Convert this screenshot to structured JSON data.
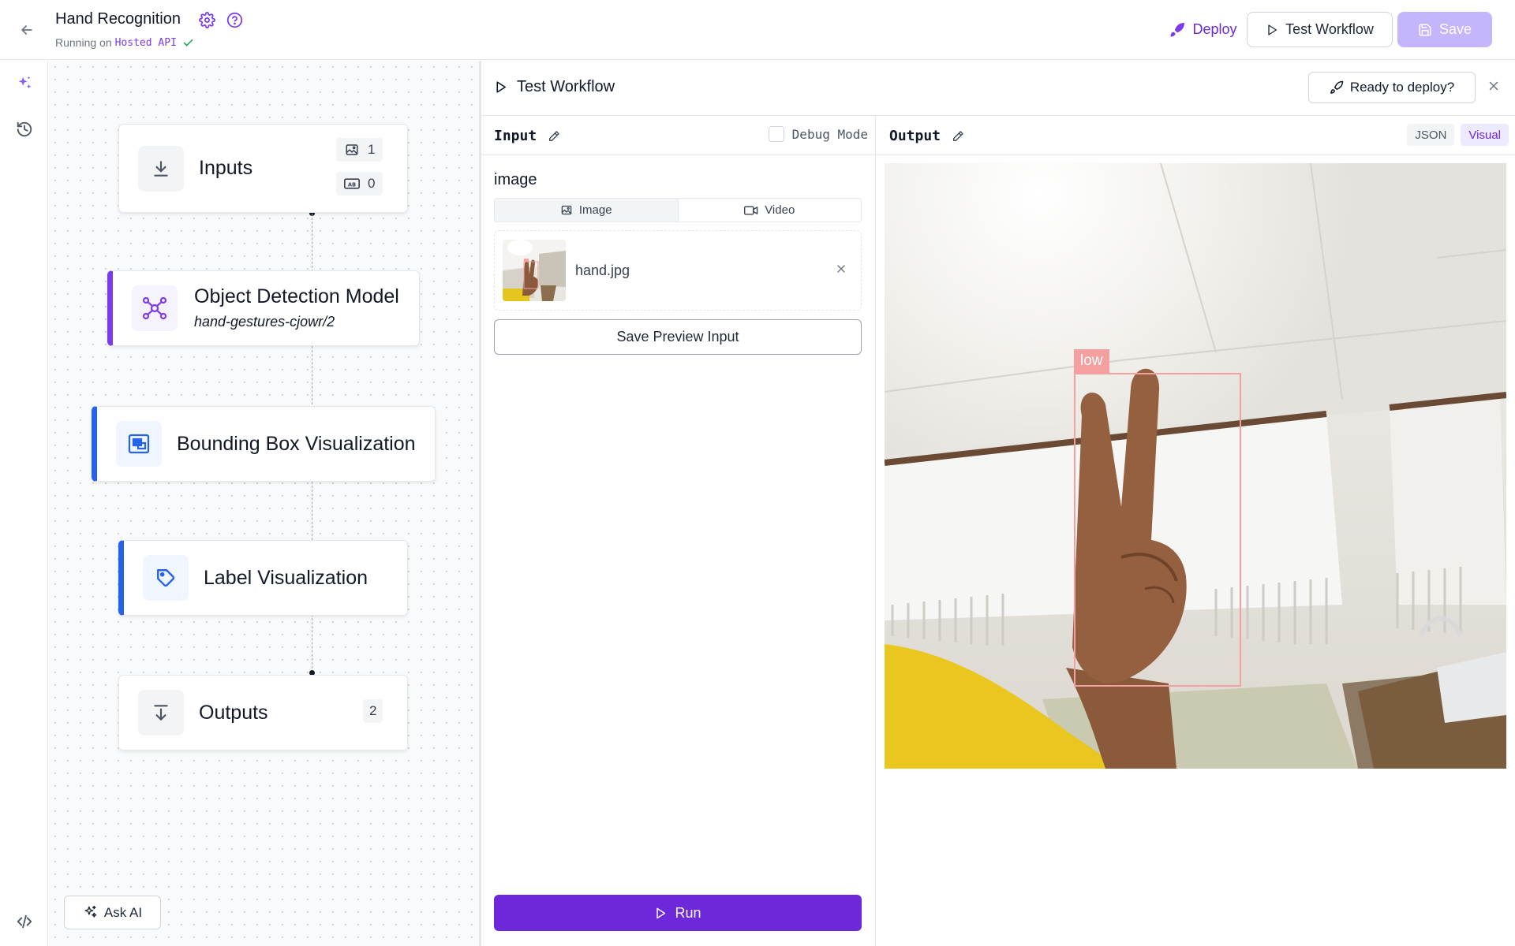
{
  "header": {
    "title": "Hand Recognition",
    "status_prefix": "Running on",
    "status_target": "Hosted API",
    "deploy_label": "Deploy",
    "test_workflow_label": "Test Workflow",
    "save_label": "Save"
  },
  "workflow": {
    "nodes": {
      "inputs": {
        "title": "Inputs",
        "image_count": "1",
        "text_count": "0"
      },
      "object_detection": {
        "title": "Object Detection Model",
        "model_id": "hand-gestures-cjowr/2"
      },
      "bbox_viz": {
        "title": "Bounding Box Visualization"
      },
      "label_viz": {
        "title": "Label Visualization"
      },
      "outputs": {
        "title": "Outputs",
        "count": "2"
      }
    },
    "ask_ai_label": "Ask AI"
  },
  "test_panel": {
    "title": "Test Workflow",
    "ready_label": "Ready to deploy?",
    "input": {
      "heading": "Input",
      "debug_label": "Debug Mode",
      "field_label": "image",
      "media_options": [
        "Image",
        "Video"
      ],
      "selected_media": "Image",
      "file_name": "hand.jpg",
      "save_preview_label": "Save Preview Input",
      "run_label": "Run"
    },
    "output": {
      "heading": "Output",
      "view_options": [
        "JSON",
        "Visual"
      ],
      "selected_view": "Visual",
      "detection_label": "low"
    }
  },
  "colors": {
    "accent": "#6d28d9",
    "accent_light": "#c4b5fd",
    "node_purple": "#7c3aed",
    "node_blue": "#2563eb",
    "detection_box": "#f4a0a0",
    "status_ok": "#16a34a"
  },
  "icons": {
    "back": "arrow-left-icon",
    "settings": "gear-icon",
    "help": "question-circle-icon",
    "deploy": "rocket-icon",
    "test": "play-icon",
    "save": "floppy-disk-icon",
    "ai": "sparkles-icon",
    "history": "history-icon",
    "code": "code-icon"
  }
}
